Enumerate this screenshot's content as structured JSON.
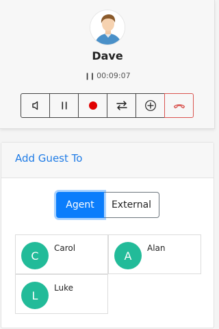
{
  "call": {
    "caller_name": "Dave",
    "timer": "00:09:07",
    "timer_icon": "pause-bars-icon",
    "controls": [
      {
        "name": "mute-speaker-button",
        "icon": "speaker-icon"
      },
      {
        "name": "hold-button",
        "icon": "pause-icon"
      },
      {
        "name": "record-button",
        "icon": "record-dot-icon",
        "color": "#e00000"
      },
      {
        "name": "transfer-button",
        "icon": "swap-arrows-icon"
      },
      {
        "name": "add-guest-button",
        "icon": "plus-circle-icon"
      },
      {
        "name": "hangup-button",
        "icon": "phone-hangup-icon",
        "color": "#d9534f"
      }
    ]
  },
  "guest": {
    "title": "Add Guest To",
    "toggle": {
      "agent_label": "Agent",
      "external_label": "External",
      "selected": "Agent"
    },
    "contacts": [
      {
        "initial": "C",
        "name": "Carol"
      },
      {
        "initial": "A",
        "name": "Alan"
      },
      {
        "initial": "L",
        "name": "Luke"
      }
    ]
  },
  "colors": {
    "accent": "#0b7dfb",
    "title_blue": "#1e7be6",
    "contact_green": "#22bb99",
    "hangup_red": "#d9534f"
  }
}
